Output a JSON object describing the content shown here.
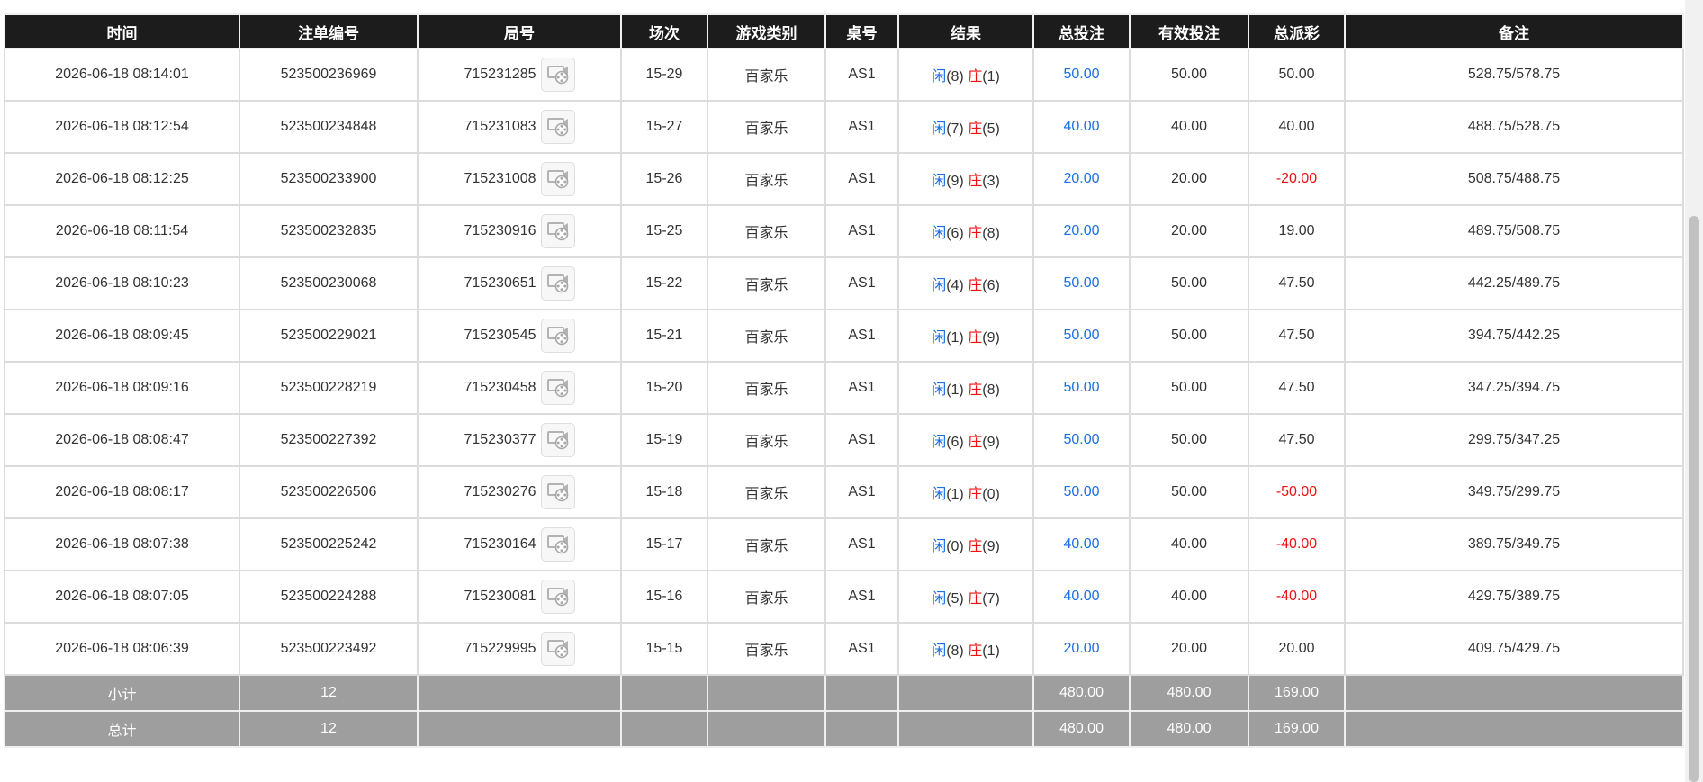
{
  "headers": [
    "时间",
    "注单编号",
    "局号",
    "场次",
    "游戏类别",
    "桌号",
    "结果",
    "总投注",
    "有效投注",
    "总派彩",
    "备注"
  ],
  "result_labels": {
    "player": "闲",
    "banker": "庄"
  },
  "rows": [
    {
      "time": "2026-06-18 08:14:01",
      "bet_id": "523500236969",
      "round_id": "715231285",
      "shoe": "15-29",
      "game": "百家乐",
      "table": "AS1",
      "player": "(8)",
      "banker": "(1)",
      "total_bet": "50.00",
      "valid_bet": "50.00",
      "payout": "50.00",
      "payout_negative": false,
      "remark": "528.75/578.75"
    },
    {
      "time": "2026-06-18 08:12:54",
      "bet_id": "523500234848",
      "round_id": "715231083",
      "shoe": "15-27",
      "game": "百家乐",
      "table": "AS1",
      "player": "(7)",
      "banker": "(5)",
      "total_bet": "40.00",
      "valid_bet": "40.00",
      "payout": "40.00",
      "payout_negative": false,
      "remark": "488.75/528.75"
    },
    {
      "time": "2026-06-18 08:12:25",
      "bet_id": "523500233900",
      "round_id": "715231008",
      "shoe": "15-26",
      "game": "百家乐",
      "table": "AS1",
      "player": "(9)",
      "banker": "(3)",
      "total_bet": "20.00",
      "valid_bet": "20.00",
      "payout": "-20.00",
      "payout_negative": true,
      "remark": "508.75/488.75"
    },
    {
      "time": "2026-06-18 08:11:54",
      "bet_id": "523500232835",
      "round_id": "715230916",
      "shoe": "15-25",
      "game": "百家乐",
      "table": "AS1",
      "player": "(6)",
      "banker": "(8)",
      "total_bet": "20.00",
      "valid_bet": "20.00",
      "payout": "19.00",
      "payout_negative": false,
      "remark": "489.75/508.75"
    },
    {
      "time": "2026-06-18 08:10:23",
      "bet_id": "523500230068",
      "round_id": "715230651",
      "shoe": "15-22",
      "game": "百家乐",
      "table": "AS1",
      "player": "(4)",
      "banker": "(6)",
      "total_bet": "50.00",
      "valid_bet": "50.00",
      "payout": "47.50",
      "payout_negative": false,
      "remark": "442.25/489.75"
    },
    {
      "time": "2026-06-18 08:09:45",
      "bet_id": "523500229021",
      "round_id": "715230545",
      "shoe": "15-21",
      "game": "百家乐",
      "table": "AS1",
      "player": "(1)",
      "banker": "(9)",
      "total_bet": "50.00",
      "valid_bet": "50.00",
      "payout": "47.50",
      "payout_negative": false,
      "remark": "394.75/442.25"
    },
    {
      "time": "2026-06-18 08:09:16",
      "bet_id": "523500228219",
      "round_id": "715230458",
      "shoe": "15-20",
      "game": "百家乐",
      "table": "AS1",
      "player": "(1)",
      "banker": "(8)",
      "total_bet": "50.00",
      "valid_bet": "50.00",
      "payout": "47.50",
      "payout_negative": false,
      "remark": "347.25/394.75"
    },
    {
      "time": "2026-06-18 08:08:47",
      "bet_id": "523500227392",
      "round_id": "715230377",
      "shoe": "15-19",
      "game": "百家乐",
      "table": "AS1",
      "player": "(6)",
      "banker": "(9)",
      "total_bet": "50.00",
      "valid_bet": "50.00",
      "payout": "47.50",
      "payout_negative": false,
      "remark": "299.75/347.25"
    },
    {
      "time": "2026-06-18 08:08:17",
      "bet_id": "523500226506",
      "round_id": "715230276",
      "shoe": "15-18",
      "game": "百家乐",
      "table": "AS1",
      "player": "(1)",
      "banker": "(0)",
      "total_bet": "50.00",
      "valid_bet": "50.00",
      "payout": "-50.00",
      "payout_negative": true,
      "remark": "349.75/299.75"
    },
    {
      "time": "2026-06-18 08:07:38",
      "bet_id": "523500225242",
      "round_id": "715230164",
      "shoe": "15-17",
      "game": "百家乐",
      "table": "AS1",
      "player": "(0)",
      "banker": "(9)",
      "total_bet": "40.00",
      "valid_bet": "40.00",
      "payout": "-40.00",
      "payout_negative": true,
      "remark": "389.75/349.75"
    },
    {
      "time": "2026-06-18 08:07:05",
      "bet_id": "523500224288",
      "round_id": "715230081",
      "shoe": "15-16",
      "game": "百家乐",
      "table": "AS1",
      "player": "(5)",
      "banker": "(7)",
      "total_bet": "40.00",
      "valid_bet": "40.00",
      "payout": "-40.00",
      "payout_negative": true,
      "remark": "429.75/389.75"
    },
    {
      "time": "2026-06-18 08:06:39",
      "bet_id": "523500223492",
      "round_id": "715229995",
      "shoe": "15-15",
      "game": "百家乐",
      "table": "AS1",
      "player": "(8)",
      "banker": "(1)",
      "total_bet": "20.00",
      "valid_bet": "20.00",
      "payout": "20.00",
      "payout_negative": false,
      "remark": "409.75/429.75"
    }
  ],
  "totals": [
    {
      "label": "小计",
      "count": "12",
      "total_bet": "480.00",
      "valid_bet": "480.00",
      "payout": "169.00"
    },
    {
      "label": "总计",
      "count": "12",
      "total_bet": "480.00",
      "valid_bet": "480.00",
      "payout": "169.00"
    }
  ],
  "icons": {
    "replay": "video-replay-icon"
  },
  "colors": {
    "header_bg": "#1c1c1c",
    "totals_bg": "#9e9e9e",
    "player_blue": "#1a6fe8",
    "banker_red": "#ee1111",
    "negative_red": "#ee1111"
  }
}
